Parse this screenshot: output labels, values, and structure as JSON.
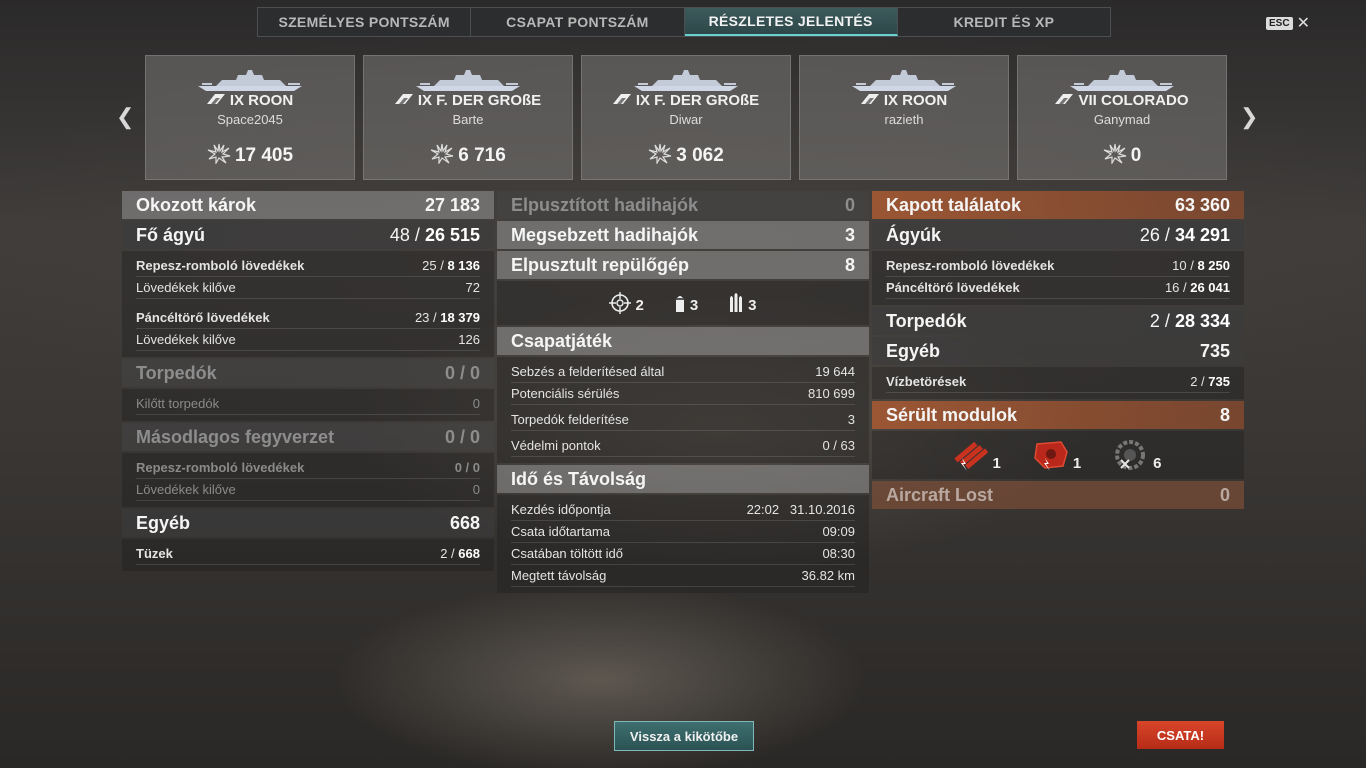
{
  "tabs": [
    "SZEMÉLYES PONTSZÁM",
    "CSAPAT PONTSZÁM",
    "RÉSZLETES JELENTÉS",
    "KREDIT ÉS XP"
  ],
  "active_tab": 2,
  "esc_label": "ESC",
  "ships": [
    {
      "name": "IX ROON",
      "player": "Space2045",
      "score": "17 405"
    },
    {
      "name": "IX F. DER GROßE",
      "player": "Barte",
      "score": "6 716"
    },
    {
      "name": "IX F. DER GROßE",
      "player": "Diwar",
      "score": "3 062"
    },
    {
      "name": "IX ROON",
      "player": "razieth",
      "score": ""
    },
    {
      "name": "VII COLORADO",
      "player": "Ganymad",
      "score": "0"
    }
  ],
  "left": {
    "damage_label": "Okozott károk",
    "damage_value": "27 183",
    "main_label": "Fő ágyú",
    "main_hits": "48 / ",
    "main_dmg": "26 515",
    "he_label": "Repesz-romboló lövedékek",
    "he_hits": "25 / ",
    "he_dmg": "8 136",
    "he_fired_label": "Lövedékek kilőve",
    "he_fired": "72",
    "ap_label": "Páncéltörő lövedékek",
    "ap_hits": "23 / ",
    "ap_dmg": "18 379",
    "ap_fired_label": "Lövedékek kilőve",
    "ap_fired": "126",
    "torp_label": "Torpedók",
    "torp_value": "0 / 0",
    "torp_fired_label": "Kilőtt torpedók",
    "torp_fired": "0",
    "sec_label": "Másodlagos fegyverzet",
    "sec_value": "0 / 0",
    "sec_he_label": "Repesz-romboló lövedékek",
    "sec_he_value": "0 / 0",
    "sec_fired_label": "Lövedékek kilőve",
    "sec_fired": "0",
    "other_label": "Egyéb",
    "other_value": "668",
    "fire_label": "Tüzek",
    "fire_hits": "2 / ",
    "fire_dmg": "668"
  },
  "middle": {
    "destroyed_label": "Elpusztított hadihajók",
    "destroyed_value": "0",
    "damaged_label": "Megsebzett hadihajók",
    "damaged_value": "3",
    "planes_label": "Elpusztult repülőgép",
    "planes_value": "8",
    "ribbons": [
      {
        "icon": "crosshair-icon",
        "count": "2"
      },
      {
        "icon": "shell-icon",
        "count": "3"
      },
      {
        "icon": "shells-icon",
        "count": "3"
      }
    ],
    "team_label": "Csapatjáték",
    "spot_label": "Sebzés a felderítésed által",
    "spot_value": "19 644",
    "pot_label": "Potenciális sérülés",
    "pot_value": "810 699",
    "torp_spot_label": "Torpedók felderítése",
    "torp_spot_value": "3",
    "defense_label": "Védelmi pontok",
    "defense_value": "0 / 63",
    "time_label": "Idő és Távolság",
    "start_label": "Kezdés időpontja",
    "start_value": "22:02   31.10.2016",
    "duration_label": "Csata időtartama",
    "duration_value": "09:09",
    "spent_label": "Csatában töltött idő",
    "spent_value": "08:30",
    "distance_label": "Megtett távolság",
    "distance_value": "36.82 km"
  },
  "right": {
    "received_label": "Kapott találatok",
    "received_value": "63 360",
    "guns_label": "Ágyúk",
    "guns_hits": "26 / ",
    "guns_dmg": "34 291",
    "he_label": "Repesz-romboló lövedékek",
    "he_hits": "10 / ",
    "he_dmg": "8 250",
    "ap_label": "Páncéltörő lövedékek",
    "ap_hits": "16 / ",
    "ap_dmg": "26 041",
    "torp_label": "Torpedók",
    "torp_hits": "2 / ",
    "torp_dmg": "28 334",
    "other_label": "Egyéb",
    "other_value": "735",
    "flood_label": "Vízbetörések",
    "flood_hits": "2 / ",
    "flood_dmg": "735",
    "modules_label": "Sérült modulok",
    "modules_value": "8",
    "module_icons": [
      {
        "icon": "torpedo-tubes-damaged-icon",
        "count": "1"
      },
      {
        "icon": "engine-damaged-icon",
        "count": "1"
      },
      {
        "icon": "turret-destroyed-icon",
        "count": "6"
      }
    ],
    "aircraft_label": "Aircraft Lost",
    "aircraft_value": "0"
  },
  "buttons": {
    "back": "Vissza a kikötőbe",
    "battle": "CSATA!"
  },
  "colors": {
    "accent_teal": "#3e6f70",
    "battle_red": "#d8452a",
    "orange_header": "#aa5a32"
  }
}
